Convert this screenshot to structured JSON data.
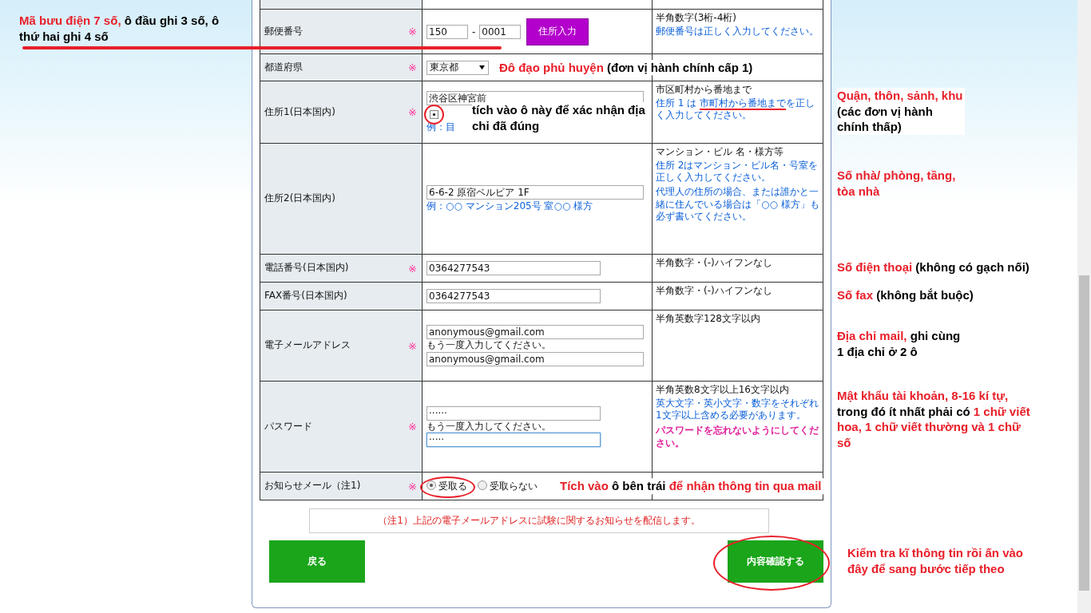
{
  "rows": [
    {
      "kind": "blank"
    },
    {
      "kind": "postal",
      "label": "郵便番号",
      "required_mark": "※",
      "inputs": [
        "150",
        "0001"
      ],
      "separator": "-",
      "button": "住所入力",
      "notes": [
        {
          "kind": "main",
          "parts": [
            "半角数字(3桁-4桁)"
          ]
        },
        {
          "kind": "hint",
          "parts": [
            "郵便番号は正しく入力してください。"
          ]
        }
      ],
      "annotations": [
        {
          "kind": "left",
          "parts": [
            {
              "t": "Mã bưu điện 7 số,",
              "color": "#e8202a"
            },
            {
              "t": " ô đầu ghi 3 số, ô thứ hai ghi 4 số",
              "color": "#000000"
            }
          ]
        }
      ]
    },
    {
      "kind": "select",
      "label": "都道府県",
      "required_mark": "※",
      "value": "東京都",
      "annotations": [
        {
          "kind": "inline",
          "parts": [
            {
              "t": "Đô đạo phủ huyện",
              "color": "#e8202a"
            },
            {
              "t": " (đơn vị hành chính cấp 1)",
              "color": "#000000"
            }
          ]
        }
      ]
    },
    {
      "kind": "address",
      "label": "住所1(日本国内)",
      "required_mark": "※",
      "value": "渋谷区神宮前",
      "checkbox": {
        "checked": true
      },
      "example": "例：目",
      "notes": [
        {
          "kind": "main",
          "parts": [
            "市区町村から番地まで"
          ]
        },
        {
          "kind": "hint",
          "parts": [
            "住所 1 は ",
            {
              "t": "市町村から番地まで",
              "underline": true
            },
            "を正しく入力してください。"
          ]
        }
      ],
      "annotations": [
        {
          "kind": "inline",
          "parts": [
            {
              "t": "tích vào ô này để xác nhận địa chỉ đã đúng",
              "color": "#000000"
            }
          ]
        },
        {
          "kind": "side",
          "parts": [
            {
              "t": "Quận, thôn, sảnh, khu",
              "color": "#e8202a"
            },
            {
              "t": " (các đơn vị hành chính thấp)",
              "color": "#000000"
            }
          ]
        }
      ]
    },
    {
      "kind": "address",
      "label": "住所2(日本国内)",
      "value": "6-6-2 原宿ベルビア 1F",
      "example": "例：○○ マンション205号 室○○ 様方",
      "notes": [
        {
          "kind": "main",
          "parts": [
            "マンション・ビル 名・様方等"
          ]
        },
        {
          "kind": "hint",
          "parts": [
            "住所 2はマンション・ビル名・号室を正しく入力してください。"
          ]
        },
        {
          "kind": "hint",
          "parts": [
            "代理人の住所の場合、または誰かと一緒に住んでいる場合は「○○ 様方」も必ず書いてください。"
          ]
        }
      ],
      "annotations": [
        {
          "kind": "side",
          "parts": [
            {
              "t": "Số nhà/ phòng, tầng, tòa nhà",
              "color": "#e8202a"
            }
          ]
        }
      ]
    },
    {
      "kind": "text",
      "label": "電話番号(日本国内)",
      "required_mark": "※",
      "value": "0364277543",
      "notes": [
        {
          "kind": "main",
          "parts": [
            "半角数字・(-)ハイフンなし"
          ]
        }
      ],
      "annotations": [
        {
          "kind": "side",
          "parts": [
            {
              "t": "Số điện thoại",
              "color": "#e8202a"
            },
            {
              "t": " (không có gạch nối)",
              "color": "#000000"
            }
          ]
        }
      ]
    },
    {
      "kind": "text",
      "label": "FAX番号(日本国内)",
      "value": "0364277543",
      "notes": [
        {
          "kind": "main",
          "parts": [
            "半角数字・(-)ハイフンなし"
          ]
        }
      ],
      "annotations": [
        {
          "kind": "side",
          "parts": [
            {
              "t": "Số fax",
              "color": "#e8202a"
            },
            {
              "t": " (không bắt buộc)",
              "color": "#000000"
            }
          ]
        }
      ]
    },
    {
      "kind": "double",
      "label": "電子メールアドレス",
      "required_mark": "※",
      "values": [
        {
          "value": "anonymous@gmail.com",
          "focused": false
        },
        {
          "value": "anonymous@gmail.com",
          "focused": false
        }
      ],
      "repeat_caption": "もう一度入力してください。",
      "notes": [
        {
          "kind": "main",
          "parts": [
            "半角英数字128文字以内"
          ]
        }
      ],
      "annotations": [
        {
          "kind": "side",
          "parts": [
            {
              "t": "Địa chỉ mail,",
              "color": "#e8202a"
            },
            {
              "t": " ghi cùng 1 địa chỉ ở 2 ô",
              "color": "#000000"
            }
          ]
        }
      ]
    },
    {
      "kind": "double",
      "label": "パスワード",
      "required_mark": "※",
      "values": [
        {
          "value": "······",
          "focused": false
        },
        {
          "value": "·····",
          "focused": true
        }
      ],
      "repeat_caption": "もう一度入力してください。",
      "notes": [
        {
          "kind": "main",
          "parts": [
            "半角英数8文字以上16文字以内"
          ]
        },
        {
          "kind": "hint",
          "parts": [
            "英大文字・英小文字・数字をそれぞれ1文字以上含める必要があります。"
          ]
        },
        {
          "kind": "warning",
          "parts": [
            "パスワードを忘れないようにしてください。"
          ]
        }
      ],
      "annotations": [
        {
          "kind": "side",
          "parts": [
            {
              "t": "Mật khẩu tài khoản, 8-16 kí tự,",
              "color": "#e8202a"
            },
            {
              "t": " trong đó ít nhất phải có ",
              "color": "#000000"
            },
            {
              "t": "1 chữ viết hoa, 1 chữ viết thường và 1 chữ số",
              "color": "#e8202a"
            }
          ]
        }
      ]
    },
    {
      "kind": "radio",
      "label": "お知らせメール（注1)",
      "required_mark": "※",
      "options": [
        {
          "label": "受取る",
          "selected": true
        },
        {
          "label": "受取らない",
          "selected": false
        }
      ],
      "annotations": [
        {
          "kind": "inline",
          "parts": [
            {
              "t": "Tích vào",
              "color": "#e8202a"
            },
            {
              "t": " ô bên trái ",
              "color": "#000000"
            },
            {
              "t": "để nhận thông tin qua mail",
              "color": "#e8202a"
            }
          ]
        }
      ]
    }
  ],
  "footnote": "（注1）上記の電子メールアドレスに試験に関するお知らせを配信します。",
  "buttons": [
    {
      "label": "戻る"
    },
    {
      "label": "内容確認する",
      "annotation": [
        {
          "t": "Kiểm tra kĩ thông tin rồi ấn vào đây để sang bước tiếp theo",
          "color": "#e8202a"
        }
      ]
    }
  ]
}
